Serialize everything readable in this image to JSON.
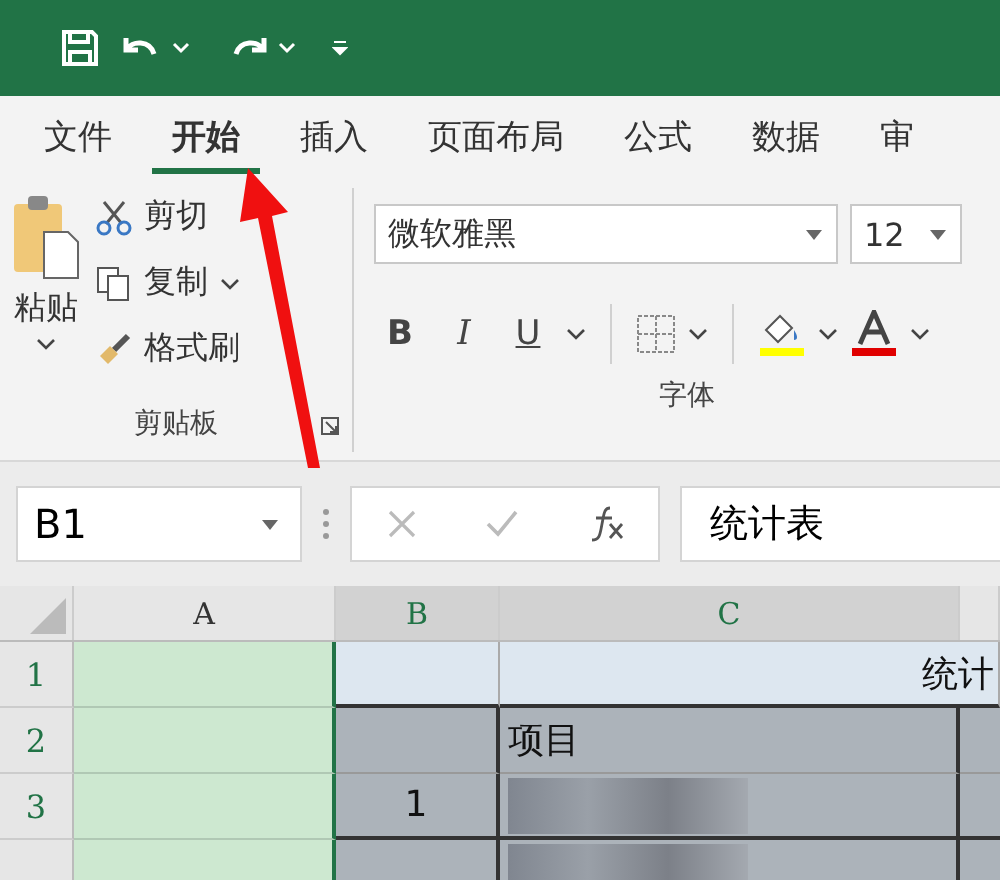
{
  "tabs": [
    {
      "label": "文件",
      "selected": false
    },
    {
      "label": "开始",
      "selected": true
    },
    {
      "label": "插入",
      "selected": false
    },
    {
      "label": "页面布局",
      "selected": false
    },
    {
      "label": "公式",
      "selected": false
    },
    {
      "label": "数据",
      "selected": false
    },
    {
      "label": "审",
      "selected": false
    }
  ],
  "clipboard": {
    "paste": "粘贴",
    "cut": "剪切",
    "copy": "复制",
    "format_painter": "格式刷",
    "label": "剪贴板"
  },
  "font": {
    "name": "微软雅黑",
    "size": "12",
    "bold": "B",
    "italic": "I",
    "underline": "U",
    "label": "字体"
  },
  "formula_bar": {
    "name_box": "B1",
    "formula": "统计表"
  },
  "columns": [
    {
      "label": "A",
      "selected": false
    },
    {
      "label": "B",
      "selected": true
    },
    {
      "label": "C",
      "selected": true
    }
  ],
  "rows": [
    {
      "label": "1",
      "cells": [
        {
          "kind": "fill",
          "text": ""
        },
        {
          "kind": "title",
          "text": ""
        },
        {
          "kind": "title",
          "text": "统计"
        }
      ]
    },
    {
      "label": "2",
      "cells": [
        {
          "kind": "fill",
          "text": ""
        },
        {
          "kind": "header",
          "text": ""
        },
        {
          "kind": "header",
          "text": "项目"
        },
        {
          "kind": "header",
          "text": ""
        }
      ]
    },
    {
      "label": "3",
      "cells": [
        {
          "kind": "fill",
          "text": ""
        },
        {
          "kind": "body",
          "text": "1"
        },
        {
          "kind": "hidden",
          "text": ""
        },
        {
          "kind": "body",
          "text": ""
        }
      ]
    },
    {
      "cells": [
        {
          "kind": "fill",
          "text": ""
        },
        {
          "kind": "body",
          "text": ""
        },
        {
          "kind": "hidden",
          "text": ""
        },
        {
          "kind": "body",
          "text": ""
        }
      ]
    }
  ]
}
